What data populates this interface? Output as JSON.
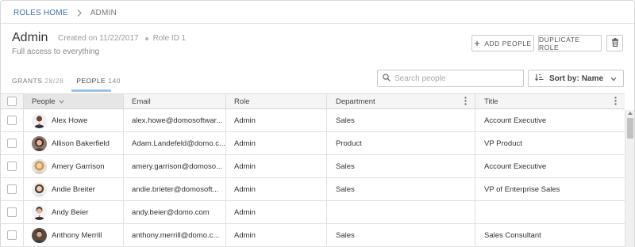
{
  "breadcrumb": {
    "home": "ROLES HOME",
    "current": "ADMIN"
  },
  "role": {
    "name": "Admin",
    "created": "Created on 11/22/2017",
    "role_id": "Role ID 1",
    "description": "Full access to everything"
  },
  "actions": {
    "add_people": "ADD PEOPLE",
    "duplicate_role": "DUPLICATE ROLE"
  },
  "tabs": [
    {
      "label": "GRANTS",
      "count": "28/28",
      "active": false
    },
    {
      "label": "PEOPLE",
      "count": "140",
      "active": true
    }
  ],
  "search": {
    "placeholder": "Search people"
  },
  "sort": {
    "label": "Sort by:",
    "value": "Name"
  },
  "table": {
    "columns": [
      "People",
      "Email",
      "Role",
      "Department",
      "Title"
    ],
    "rows": [
      {
        "name": "Alex Howe",
        "email": "alex.howe@domosoftwar...",
        "role": "Admin",
        "department": "Sales",
        "title": "Account Executive"
      },
      {
        "name": "Allison Bakerfield",
        "email": "Adam.Landefeld@domo.c...",
        "role": "Admin",
        "department": "Product",
        "title": "VP Product"
      },
      {
        "name": "Amery Garrison",
        "email": "amery.garrison@domoso...",
        "role": "Admin",
        "department": "Sales",
        "title": "Account Executive"
      },
      {
        "name": "Andie Breiter",
        "email": "andie.brieter@domosoft...",
        "role": "Admin",
        "department": "Sales",
        "title": "VP of Enterprise Sales"
      },
      {
        "name": "Andy Beier",
        "email": "andy.beier@domo.com",
        "role": "Admin",
        "department": "",
        "title": ""
      },
      {
        "name": "Anthony Merrill",
        "email": "anthony.merrill@domo.c...",
        "role": "Admin",
        "department": "Sales",
        "title": "Sales Consultant"
      }
    ]
  },
  "colors": {
    "link": "#3f6fae",
    "tab_underline": "#99c3e6",
    "header_bg": "#f5f5f5"
  }
}
